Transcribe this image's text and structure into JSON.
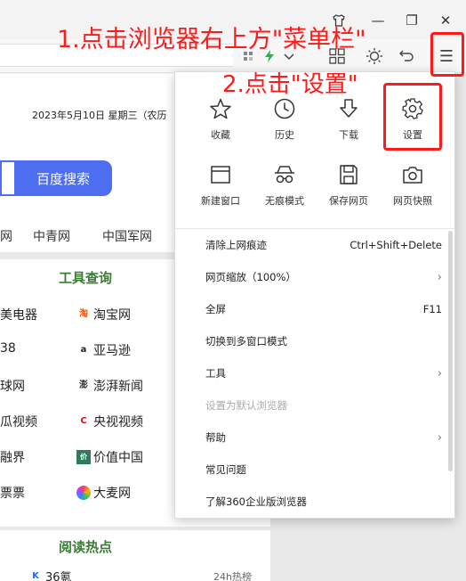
{
  "window": {
    "shirt_icon": "shirt-icon",
    "minimize_glyph": "—",
    "restore_glyph": "❐",
    "close_glyph": "✕"
  },
  "toolbar": {
    "icons": [
      "ext-icon",
      "flash-icon",
      "dropdown-icon",
      "apps-grid-icon",
      "brightness-icon",
      "undo-icon"
    ],
    "menu_glyph": "☰"
  },
  "page": {
    "date": "2023年5月10日 星期三（农历",
    "search_button": "百度搜索",
    "nav_links": [
      "网",
      "中青网",
      "中国军网"
    ],
    "tools_title": "工具查询",
    "tools_left": [
      "美电器",
      "38",
      "球网",
      "瓜视频",
      "融界",
      "票票"
    ],
    "tools_right": [
      "淘宝网",
      "亚马逊",
      "澎湃新闻",
      "央视视频",
      "价值中国",
      "大麦网"
    ],
    "reading_title": "阅读热点",
    "reading_item": "36氪",
    "reading_meta": "24h热榜"
  },
  "menu": {
    "top_row": [
      {
        "label": "收藏",
        "icon": "star-icon"
      },
      {
        "label": "历史",
        "icon": "clock-icon"
      },
      {
        "label": "下载",
        "icon": "download-icon"
      },
      {
        "label": "设置",
        "icon": "gear-icon"
      }
    ],
    "second_row": [
      {
        "label": "新建窗口",
        "icon": "window-icon"
      },
      {
        "label": "无痕模式",
        "icon": "incognito-icon"
      },
      {
        "label": "保存网页",
        "icon": "save-icon"
      },
      {
        "label": "网页快照",
        "icon": "camera-icon"
      }
    ],
    "items": [
      {
        "label": "清除上网痕迹",
        "shortcut": "Ctrl+Shift+Delete"
      },
      {
        "label": "网页缩放（100%）",
        "shortcut": "›"
      },
      {
        "label": "全屏",
        "shortcut": "F11"
      },
      {
        "label": "切换到多窗口模式",
        "shortcut": ""
      },
      {
        "label": "工具",
        "shortcut": "›"
      },
      {
        "label": "设置为默认浏览器",
        "shortcut": ""
      },
      {
        "label": "帮助",
        "shortcut": "›"
      },
      {
        "label": "常见问题",
        "shortcut": ""
      },
      {
        "label": "了解360企业版浏览器",
        "shortcut": ""
      }
    ]
  },
  "annotations": {
    "step1": "1.点击浏览器右上方\"菜单栏\"",
    "step2": "2.点击\"设置\"",
    "color": "#ff1a1a"
  }
}
